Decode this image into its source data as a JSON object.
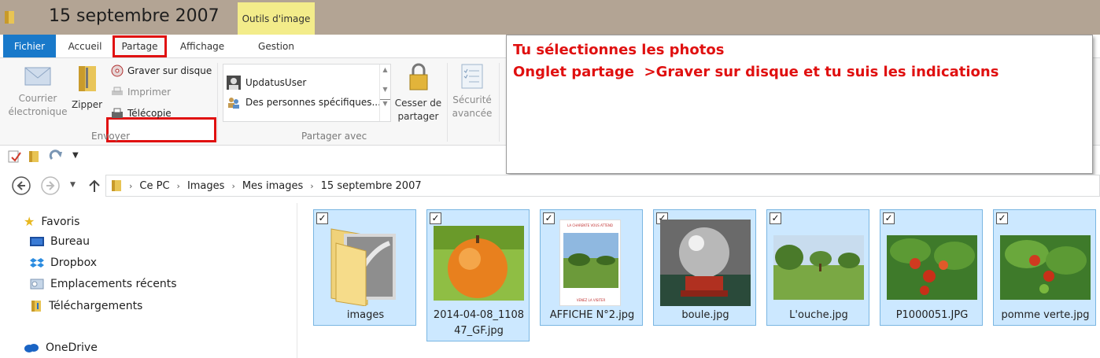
{
  "window": {
    "title": "15 septembre 2007",
    "context_tab": "Outils d'image"
  },
  "tabs": {
    "file": "Fichier",
    "home": "Accueil",
    "share": "Partage",
    "view": "Affichage",
    "manage": "Gestion"
  },
  "ribbon": {
    "email": [
      "Courrier",
      "électronique"
    ],
    "zip": "Zipper",
    "burn": "Graver sur disque",
    "print": "Imprimer",
    "fax": "Télécopie",
    "send_group": "Envoyer",
    "share_with_items": [
      "UpdatusUser",
      "Des personnes spécifiques..."
    ],
    "share_with_group": "Partager avec",
    "stop_sharing": [
      "Cesser de",
      "partager"
    ],
    "advanced_security": [
      "Sécurité",
      "avancée"
    ]
  },
  "annotation": {
    "line1": "Tu sélectionnes les photos",
    "line2": "Onglet partage  >Graver sur disque et tu suis les indications"
  },
  "breadcrumb": [
    "Ce PC",
    "Images",
    "Mes images",
    "15 septembre 2007"
  ],
  "nav": {
    "favorites": "Favoris",
    "items": [
      "Bureau",
      "Dropbox",
      "Emplacements récents",
      "Téléchargements"
    ],
    "onedrive": "OneDrive"
  },
  "files": [
    {
      "name": "images"
    },
    {
      "name_lines": [
        "2014-04-08_1108",
        "47_GF.jpg"
      ]
    },
    {
      "name": "AFFICHE N°2.jpg",
      "poster_top": "LA CHARENTE VOUS ATTEND",
      "poster_bottom": "VENEZ LA VISITER"
    },
    {
      "name": "boule.jpg"
    },
    {
      "name": "L'ouche.jpg"
    },
    {
      "name": "P1000051.JPG"
    },
    {
      "name": "pomme verte.jpg"
    }
  ],
  "colors": {
    "file_tab": "#1979ca",
    "selection": "#cce8ff",
    "annotation": "#e01010",
    "titlebar": "#b3a494"
  }
}
